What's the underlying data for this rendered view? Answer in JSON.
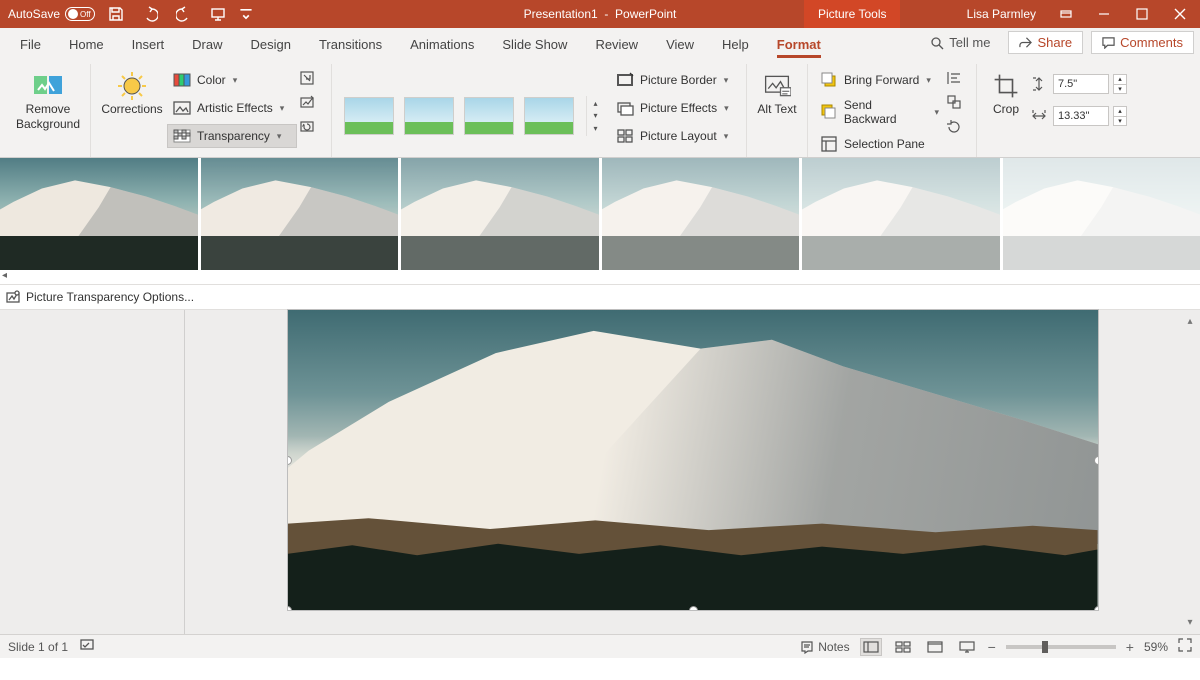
{
  "titlebar": {
    "autosave_label": "AutoSave",
    "autosave_state": "Off",
    "doc_name": "Presentation1",
    "app_name": "PowerPoint",
    "contextual_tab": "Picture Tools",
    "user_name": "Lisa Parmley"
  },
  "tabs": {
    "items": [
      "File",
      "Home",
      "Insert",
      "Draw",
      "Design",
      "Transitions",
      "Animations",
      "Slide Show",
      "Review",
      "View",
      "Help",
      "Format"
    ],
    "active_index": 11,
    "tellme": "Tell me",
    "share": "Share",
    "comments": "Comments"
  },
  "ribbon": {
    "remove_bg": "Remove Background",
    "corrections": "Corrections",
    "color": "Color",
    "artistic": "Artistic Effects",
    "transparency": "Transparency",
    "border": "Picture Border",
    "effects": "Picture Effects",
    "layout": "Picture Layout",
    "alt_text": "Alt Text",
    "bring_forward": "Bring Forward",
    "send_backward": "Send Backward",
    "selection_pane": "Selection Pane",
    "crop": "Crop",
    "height_val": "7.5\"",
    "width_val": "13.33\""
  },
  "transparency_gallery": {
    "presets": [
      {
        "opacity": 0
      },
      {
        "opacity": 0.12
      },
      {
        "opacity": 0.3
      },
      {
        "opacity": 0.45
      },
      {
        "opacity": 0.62
      },
      {
        "opacity": 0.82
      }
    ],
    "options_label": "Picture Transparency Options..."
  },
  "statusbar": {
    "slide_info": "Slide 1 of 1",
    "notes": "Notes",
    "zoom": "59%"
  }
}
